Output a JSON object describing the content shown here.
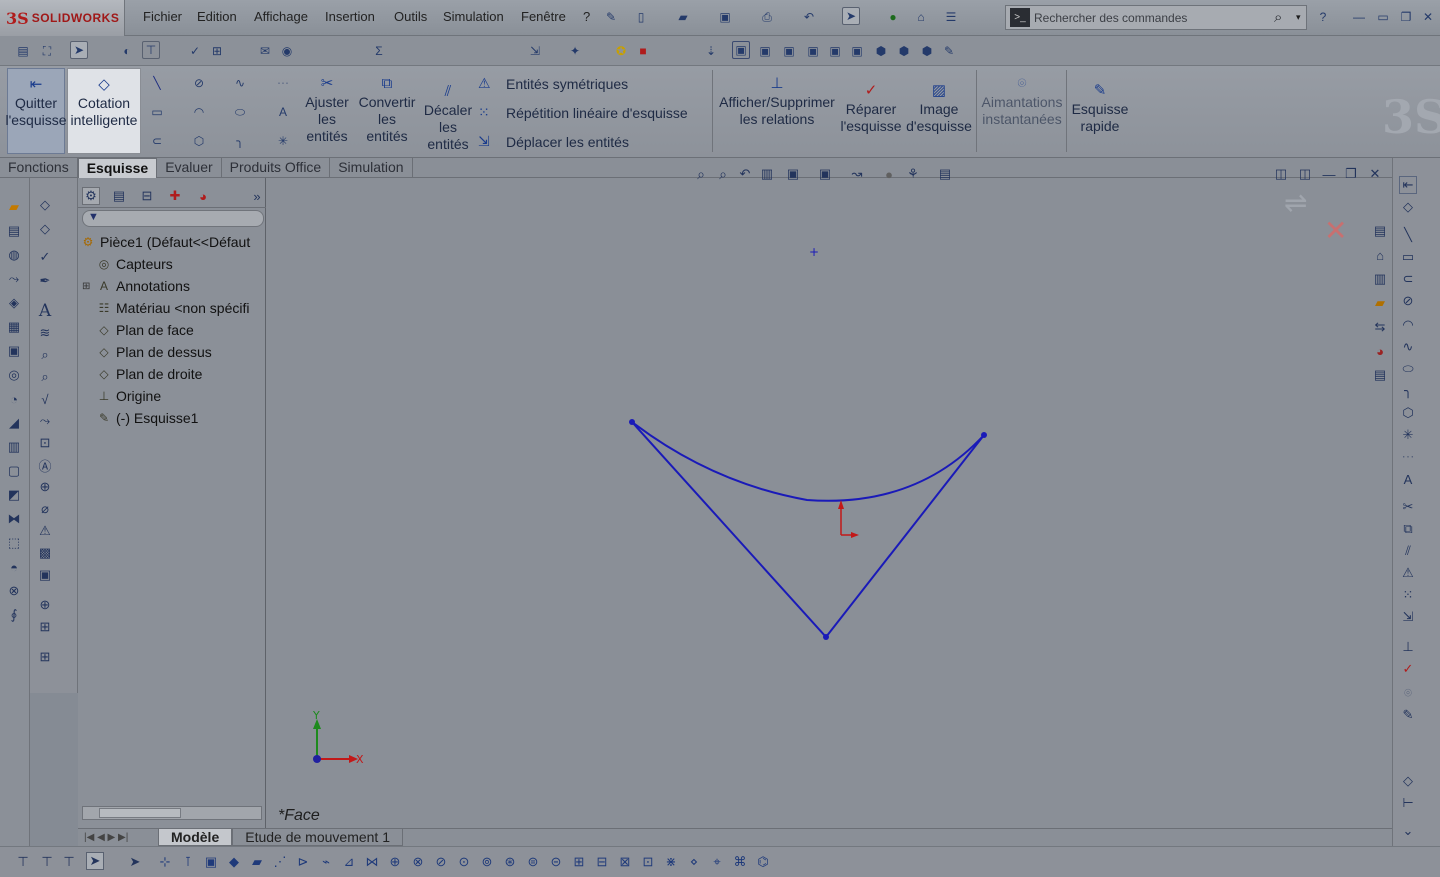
{
  "app": {
    "logo_ds": "3S",
    "logo_name": "SOLIDWORKS"
  },
  "menu": {
    "items": [
      "Fichier",
      "Edition",
      "Affichage",
      "Insertion",
      "Outils",
      "Simulation",
      "Fenêtre",
      "?"
    ]
  },
  "search": {
    "placeholder": "Rechercher des commandes"
  },
  "ribbon": {
    "quit_sketch": "Quitter l'esquisse",
    "smart_dimension": "Cotation intelligente",
    "trim": "Ajuster les entités",
    "convert": "Convertir les entités",
    "offset": "Décaler les entités",
    "mirror": "Entités symétriques",
    "linear_pattern": "Répétition linéaire d'esquisse",
    "move": "Déplacer les entités",
    "relations": "Afficher/Supprimer les relations",
    "repair": "Réparer l'esquisse",
    "sketch_picture": "Image d'esquisse",
    "snaps": "Aimantations instantanées",
    "rapid_sketch": "Esquisse rapide"
  },
  "tabs": [
    {
      "label": "Fonctions",
      "active": false
    },
    {
      "label": "Esquisse",
      "active": true
    },
    {
      "label": "Evaluer",
      "active": false
    },
    {
      "label": "Produits Office",
      "active": false
    },
    {
      "label": "Simulation",
      "active": false
    }
  ],
  "tree": {
    "root": "Pièce1  (Défaut<<Défaut",
    "items": [
      {
        "label": "Capteurs",
        "icon": "sensor-icon"
      },
      {
        "label": "Annotations",
        "icon": "annotation-icon"
      },
      {
        "label": "Matériau <non spécifi",
        "icon": "material-icon"
      },
      {
        "label": "Plan de face",
        "icon": "plane-icon"
      },
      {
        "label": "Plan de dessus",
        "icon": "plane-icon"
      },
      {
        "label": "Plan de droite",
        "icon": "plane-icon"
      },
      {
        "label": "Origine",
        "icon": "origin-icon"
      },
      {
        "label": "(-) Esquisse1",
        "icon": "sketch-icon"
      }
    ]
  },
  "viewport": {
    "view_name": "*Face",
    "axis_x": "X",
    "axis_y": "Y"
  },
  "bottom_tabs": [
    {
      "label": "Modèle",
      "active": true
    },
    {
      "label": "Etude de mouvement 1",
      "active": false
    }
  ],
  "colors": {
    "sketch_line": "#1a1ab8",
    "origin_red": "#c21818",
    "logo_red": "#b01c1c"
  }
}
